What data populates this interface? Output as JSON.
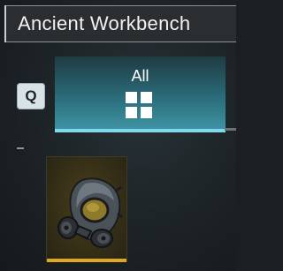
{
  "window": {
    "title": "Ancient Workbench"
  },
  "hotkey": {
    "label": "Q"
  },
  "tabs": [
    {
      "label": "All",
      "icon": "grid-icon",
      "active": true
    }
  ],
  "inventory": {
    "slots": [
      {
        "item_icon": "gas-mask-icon",
        "rarity_color": "#e0a81e"
      }
    ]
  },
  "colors": {
    "accent": "#7fd8ec",
    "rarity": "#e0a81e"
  }
}
